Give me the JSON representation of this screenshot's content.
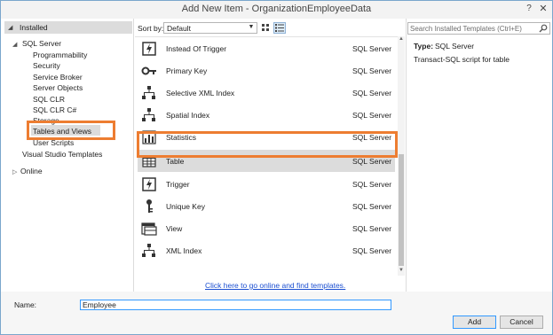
{
  "window": {
    "title": "Add New Item - OrganizationEmployeeData",
    "help_glyph": "?",
    "close_glyph": "✕"
  },
  "tree": {
    "installed": "Installed",
    "sql_server": "SQL Server",
    "children": [
      "Programmability",
      "Security",
      "Service Broker",
      "Server Objects",
      "SQL CLR",
      "SQL CLR C#",
      "Storage",
      "Tables and Views",
      "User Scripts"
    ],
    "visual_studio_templates": "Visual Studio Templates",
    "online": "Online",
    "selected": "Tables and Views"
  },
  "sort": {
    "label": "Sort by:",
    "value": "Default"
  },
  "templates": [
    {
      "name": "Instead Of Trigger",
      "category": "SQL Server",
      "icon": "trigger-icon"
    },
    {
      "name": "Primary Key",
      "category": "SQL Server",
      "icon": "key-icon"
    },
    {
      "name": "Selective XML Index",
      "category": "SQL Server",
      "icon": "hierarchy-icon"
    },
    {
      "name": "Spatial Index",
      "category": "SQL Server",
      "icon": "hierarchy-icon"
    },
    {
      "name": "Statistics",
      "category": "SQL Server",
      "icon": "statistics-icon"
    },
    {
      "name": "Table",
      "category": "SQL Server",
      "icon": "table-icon"
    },
    {
      "name": "Trigger",
      "category": "SQL Server",
      "icon": "trigger-icon"
    },
    {
      "name": "Unique Key",
      "category": "SQL Server",
      "icon": "unique-key-icon"
    },
    {
      "name": "View",
      "category": "SQL Server",
      "icon": "view-icon"
    },
    {
      "name": "XML Index",
      "category": "SQL Server",
      "icon": "hierarchy-icon"
    }
  ],
  "online_link": "Click here to go online and find templates.",
  "search": {
    "placeholder": "Search Installed Templates (Ctrl+E)"
  },
  "details": {
    "type_label": "Type:",
    "type_value": "SQL Server",
    "description": "Transact-SQL script for table"
  },
  "name_field": {
    "label": "Name:",
    "value": "Employee"
  },
  "buttons": {
    "add": "Add",
    "cancel": "Cancel"
  },
  "colors": {
    "highlight": "#ed7d31",
    "link": "#1b4fd1",
    "selection": "#dcdcdc"
  }
}
